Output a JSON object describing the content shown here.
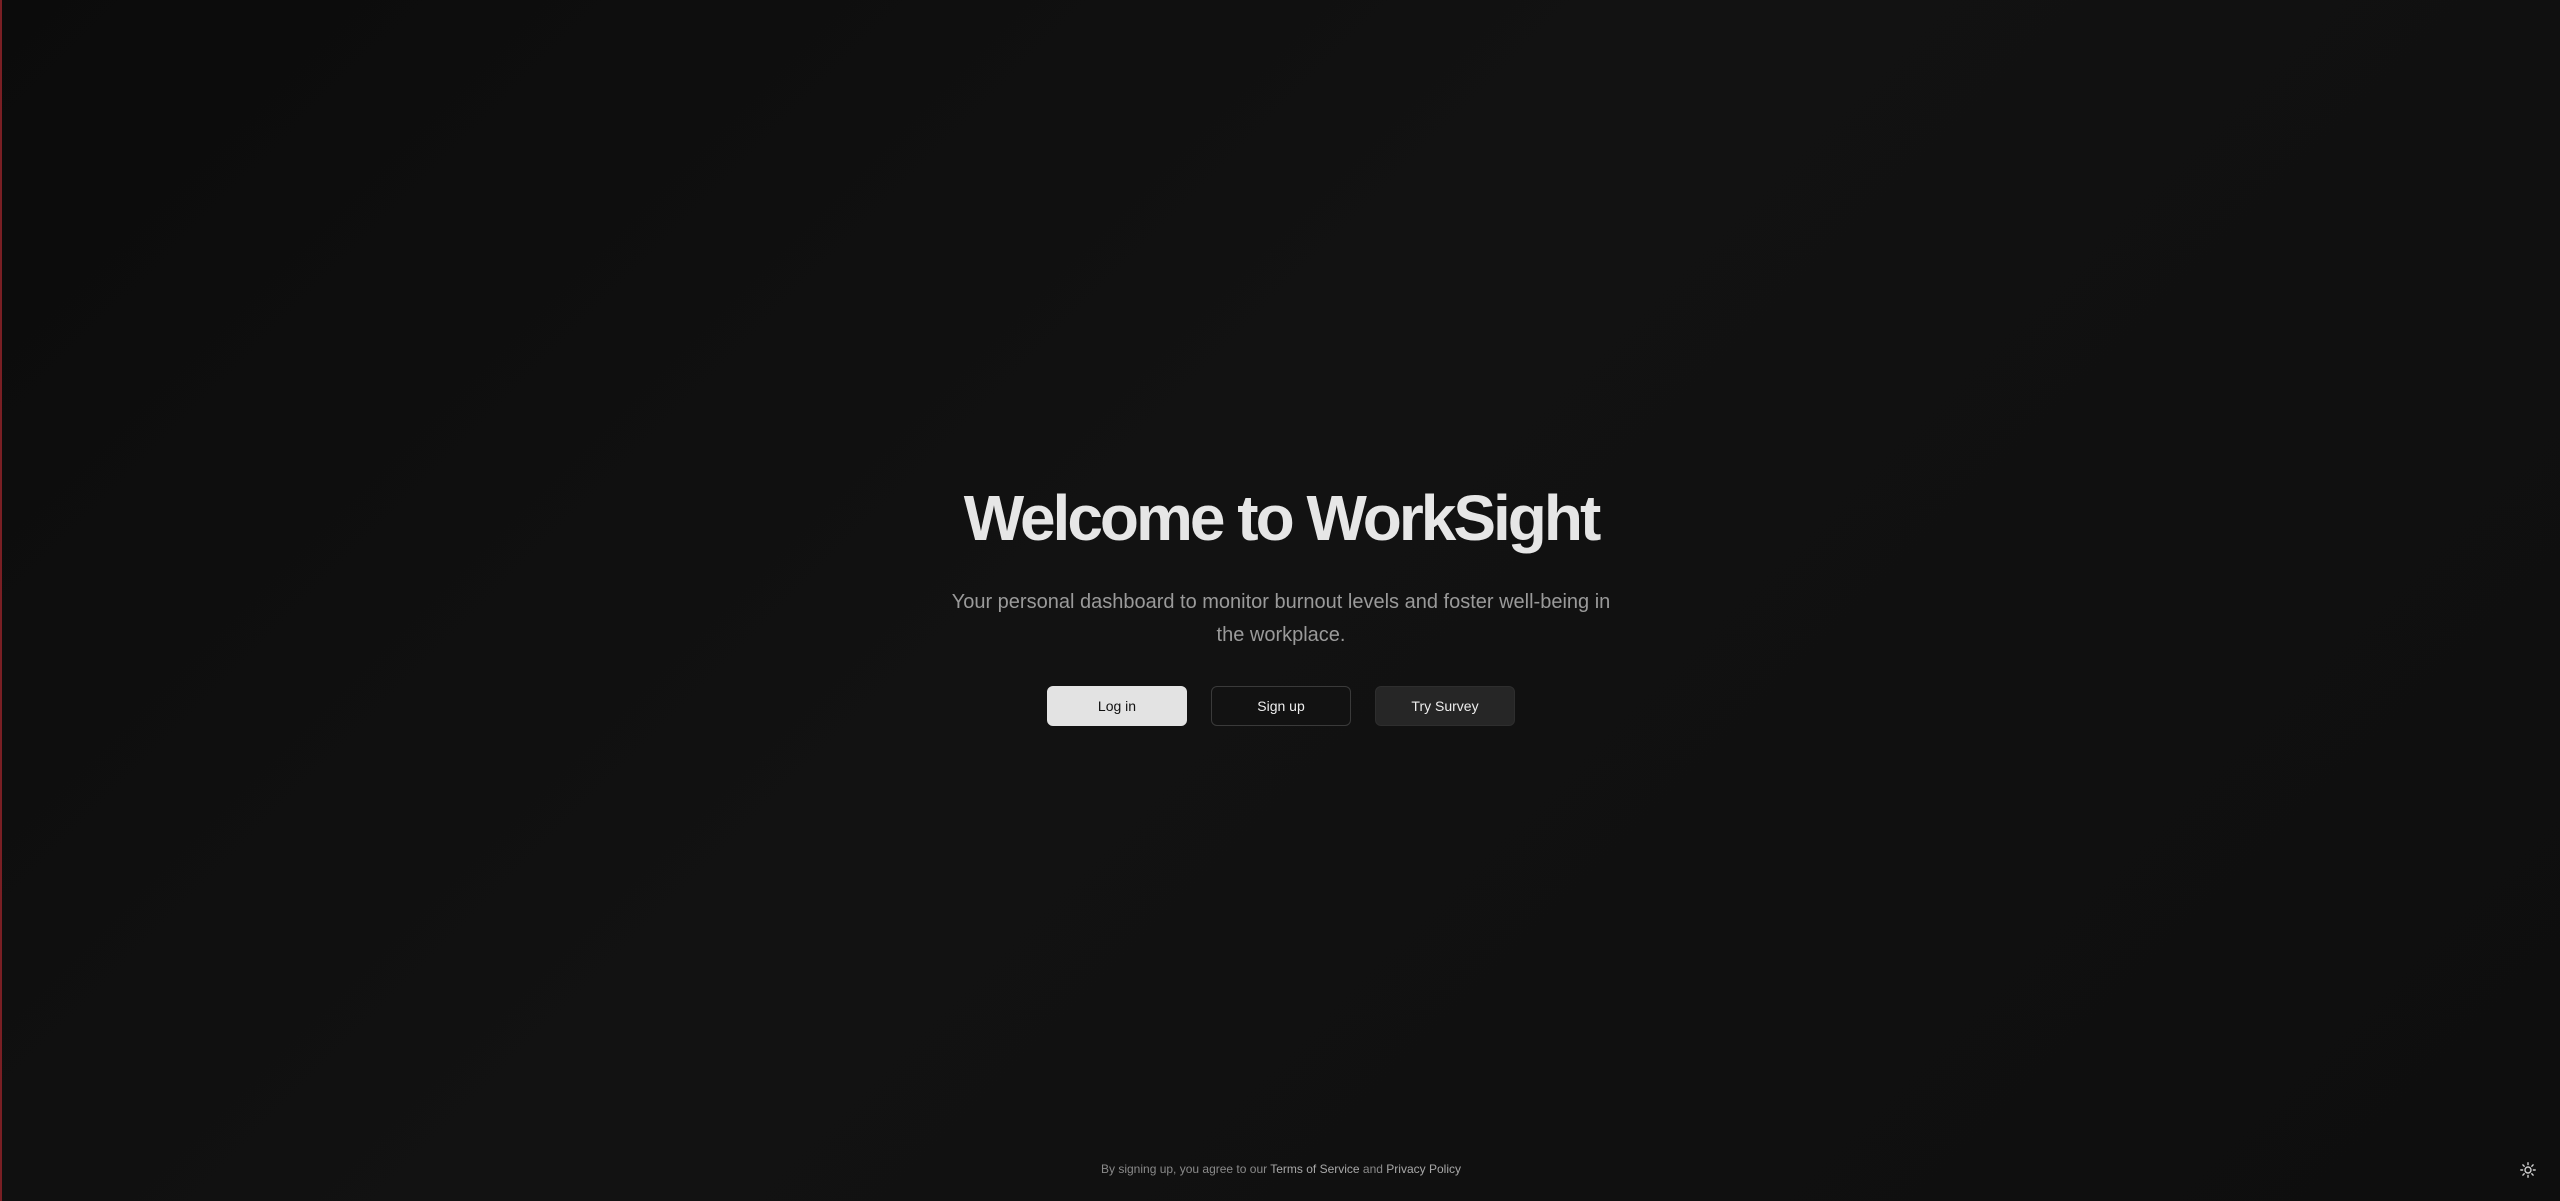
{
  "hero": {
    "title": "Welcome to WorkSight",
    "subtitle": "Your personal dashboard to monitor burnout levels and foster well-being in the workplace."
  },
  "actions": {
    "login_label": "Log in",
    "signup_label": "Sign up",
    "survey_label": "Try Survey"
  },
  "footer": {
    "prefix": "By signing up, you agree to our ",
    "terms_label": "Terms of Service",
    "conjunction": " and ",
    "privacy_label": "Privacy Policy"
  },
  "theme_toggle": {
    "icon": "sun-icon"
  },
  "colors": {
    "background": "#0d0d0d",
    "title": "#e6e6e6",
    "primary_button": "#e3e3e3",
    "accent_edge": "#7a1f24"
  }
}
